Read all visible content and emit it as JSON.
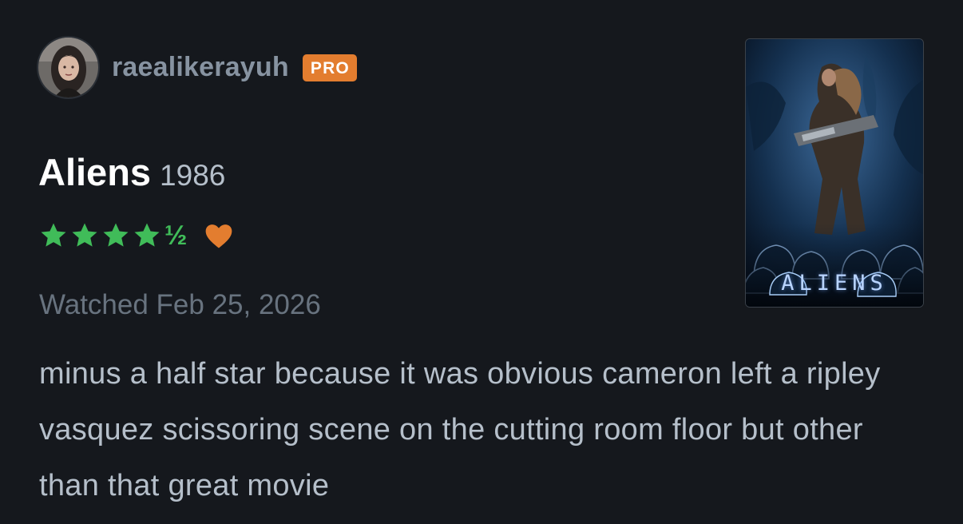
{
  "author": {
    "username": "raealikerayuh",
    "badge": "PRO",
    "avatar_icon": "user-avatar"
  },
  "film": {
    "title": "Aliens",
    "year": "1986",
    "poster_title": "ALIENS"
  },
  "rating": {
    "stars": 4.5,
    "half_symbol": "½",
    "liked": true,
    "star_color": "#40bc59",
    "like_color": "#e37d2f"
  },
  "watched": "Watched Feb 25, 2026",
  "review_text": "minus a half star because it was obvious cameron left a ripley vasquez scissoring scene on the cutting room floor but other than that great movie",
  "colors": {
    "background": "#15181d",
    "badge": "#e37d2f",
    "muted_text": "#68737f",
    "body_text": "#b5bfca"
  }
}
